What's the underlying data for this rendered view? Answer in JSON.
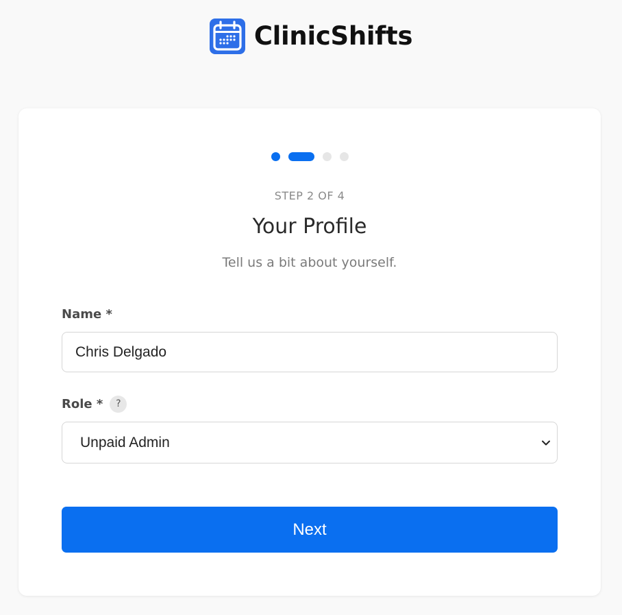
{
  "app": {
    "brand_name": "ClinicShifts",
    "logo_icon": "calendar-icon",
    "accent_color": "#0a6ff0"
  },
  "wizard": {
    "current_step": 2,
    "total_steps": 4,
    "step_label": "STEP 2 OF 4",
    "title": "Your Profile",
    "subtitle": "Tell us a bit about yourself."
  },
  "form": {
    "name": {
      "label": "Name *",
      "value": "Chris Delgado",
      "placeholder": ""
    },
    "role": {
      "label": "Role *",
      "help_icon": "question-mark-icon",
      "help_glyph": "?",
      "selected": "Unpaid Admin",
      "chevron_icon": "chevron-down-icon"
    },
    "next_label": "Next"
  }
}
